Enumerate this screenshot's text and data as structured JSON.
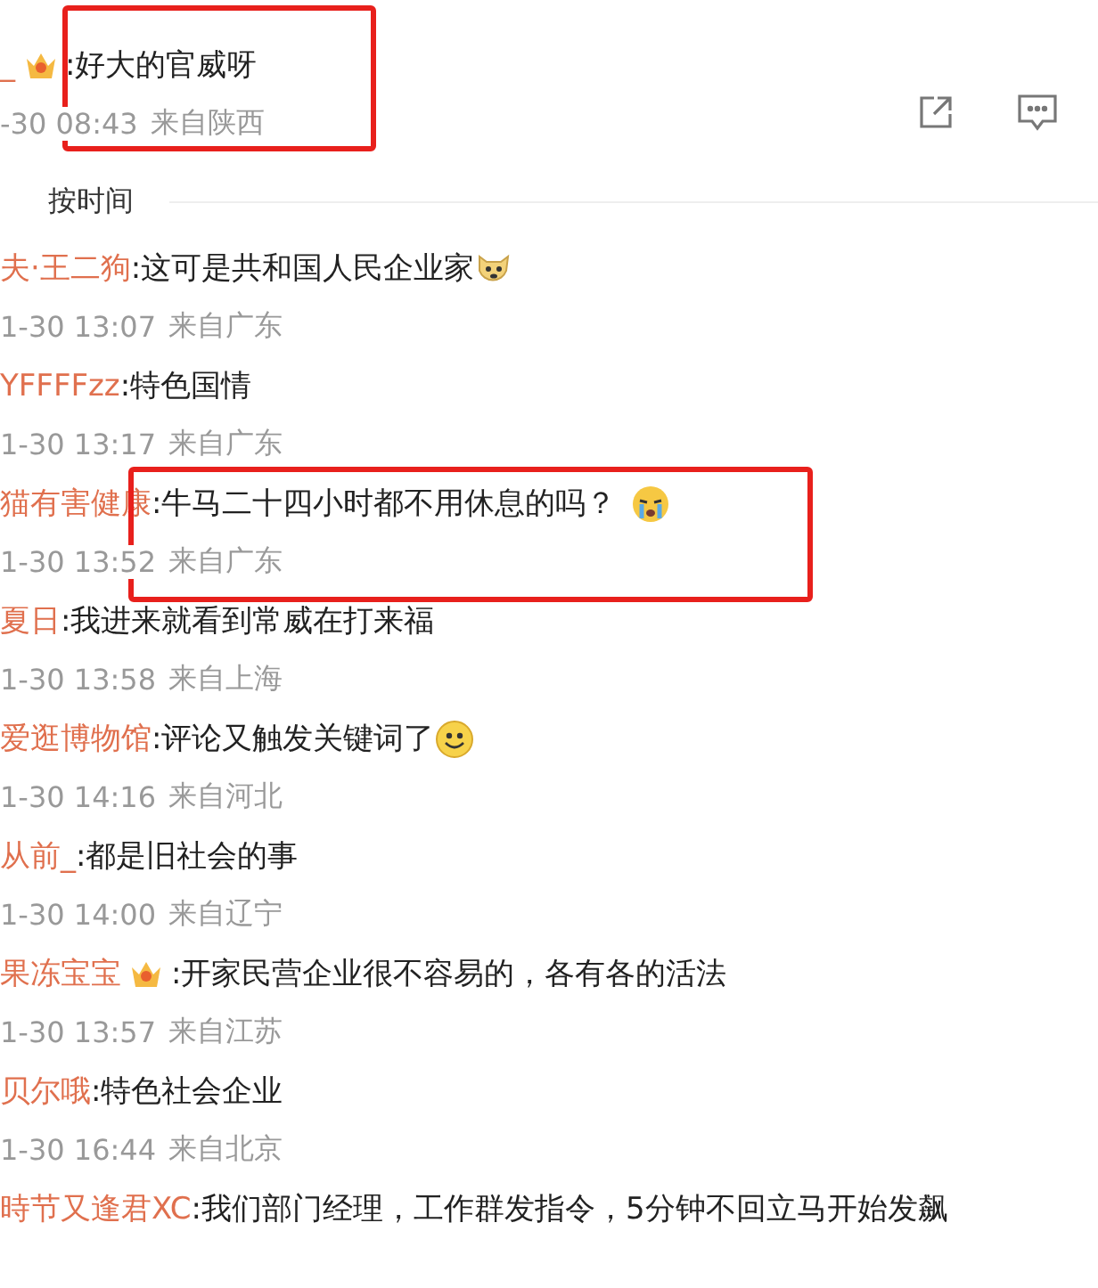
{
  "post": {
    "name": "_",
    "badge": {
      "kind": "crown"
    },
    "text": ":好大的官威呀",
    "time": "-30 08:43",
    "source": "来自陕西",
    "highlighted": true
  },
  "sort": {
    "label": "按时间"
  },
  "comments": [
    {
      "name": "夫·王二狗",
      "text": ":这可是共和国人民企业家",
      "emoji": {
        "kind": "doge"
      },
      "time": "1-30 13:07",
      "source": "来自广东",
      "highlighted": false
    },
    {
      "name": "YFFFFzz",
      "text": ":特色国情",
      "time": "1-30 13:17",
      "source": "来自广东",
      "highlighted": false
    },
    {
      "name": "猫有害健康",
      "text": ":牛马二十四小时都不用休息的吗？",
      "emoji": {
        "kind": "cry"
      },
      "time": "1-30 13:52",
      "source": "来自广东",
      "highlighted": true
    },
    {
      "name": "夏日",
      "text": ":我进来就看到常威在打来福",
      "time": "1-30 13:58",
      "source": "来自上海",
      "highlighted": false
    },
    {
      "name": "爱逛博物馆",
      "text": ":评论又触发关键词了",
      "emoji": {
        "kind": "smile"
      },
      "time": "1-30 14:16",
      "source": "来自河北",
      "highlighted": false
    },
    {
      "name": "从前_",
      "text": ":都是旧社会的事",
      "time": "1-30 14:00",
      "source": "来自辽宁",
      "highlighted": false
    },
    {
      "name": "果冻宝宝",
      "badge": {
        "kind": "crown"
      },
      "text": ":开家民营企业很不容易的，各有各的活法",
      "time": "1-30 13:57",
      "source": "来自江苏",
      "highlighted": false
    },
    {
      "name": "贝尔哦",
      "text": ":特色社会企业",
      "time": "1-30 16:44",
      "source": "来自北京",
      "highlighted": false
    },
    {
      "name": "時节又逢君XC",
      "text": ":我们部门经理，工作群发指令，5分钟不回立马开始发飙",
      "highlighted": false
    }
  ]
}
